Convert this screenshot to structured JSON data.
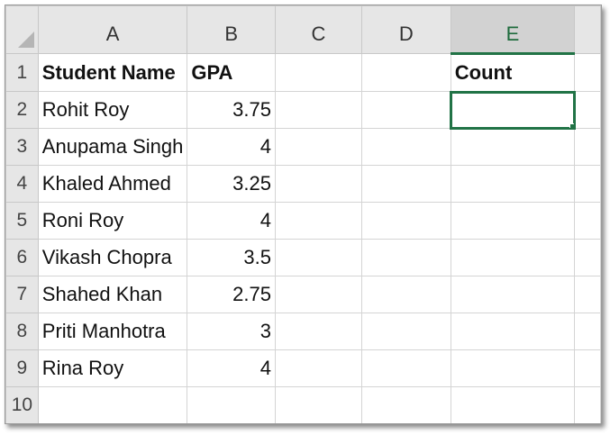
{
  "columns": [
    "A",
    "B",
    "C",
    "D",
    "E"
  ],
  "rows": [
    {
      "num": "1",
      "a": "Student Name",
      "b": "GPA",
      "e": "Count"
    },
    {
      "num": "2",
      "a": "Rohit Roy",
      "b": "3.75",
      "e": ""
    },
    {
      "num": "3",
      "a": "Anupama Singh",
      "b": "4"
    },
    {
      "num": "4",
      "a": "Khaled Ahmed",
      "b": "3.25"
    },
    {
      "num": "5",
      "a": "Roni Roy",
      "b": "4"
    },
    {
      "num": "6",
      "a": "Vikash Chopra",
      "b": "3.5"
    },
    {
      "num": "7",
      "a": "Shahed Khan",
      "b": "2.75"
    },
    {
      "num": "8",
      "a": "Priti Manhotra",
      "b": "3"
    },
    {
      "num": "9",
      "a": "Rina Roy",
      "b": "4"
    },
    {
      "num": "10",
      "a": "",
      "b": ""
    }
  ],
  "colors": {
    "accent": "#217346"
  }
}
